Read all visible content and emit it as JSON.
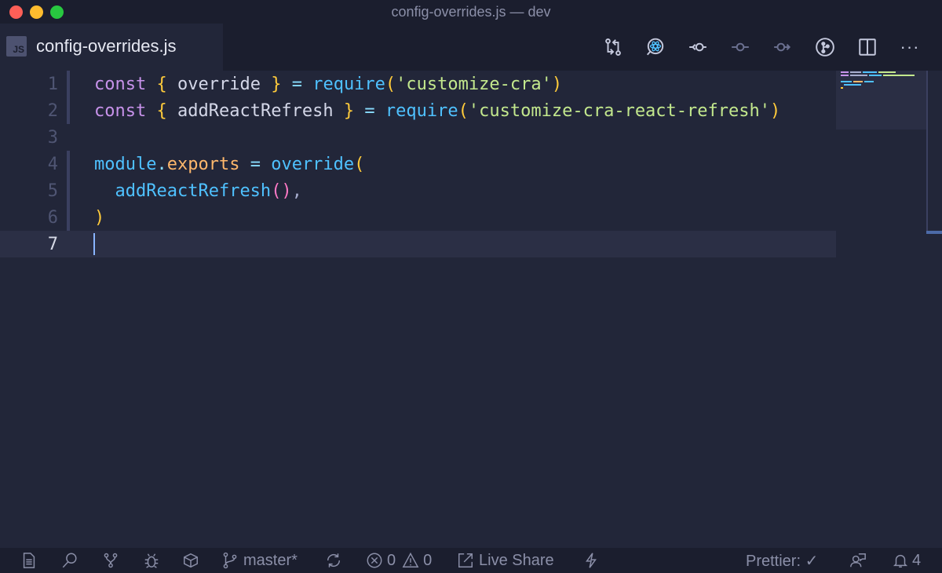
{
  "window": {
    "title": "config-overrides.js — dev"
  },
  "tab": {
    "badge": "JS",
    "label": "config-overrides.js"
  },
  "toolbar": {
    "icons": [
      "compare-changes-icon",
      "react-search-icon",
      "go-back-commit-icon",
      "commit-icon",
      "go-forward-commit-icon",
      "git-graph-icon",
      "split-editor-icon",
      "more-actions-icon"
    ],
    "more_label": "···"
  },
  "editor": {
    "lines": [
      {
        "number": "1"
      },
      {
        "number": "2"
      },
      {
        "number": "3"
      },
      {
        "number": "4"
      },
      {
        "number": "5"
      },
      {
        "number": "6"
      },
      {
        "number": "7"
      }
    ],
    "tokens": {
      "l1": [
        "const",
        " { ",
        "override",
        " } ",
        "= ",
        "require",
        "(",
        "'customize-cra'",
        ")"
      ],
      "l2": [
        "const",
        " { ",
        "addReactRefresh",
        " } ",
        "= ",
        "require",
        "(",
        "'customize-cra-react-refresh'",
        ")"
      ],
      "l4": [
        "module",
        ".",
        "exports",
        " = ",
        "override",
        "("
      ],
      "l5": [
        "  ",
        "addReactRefresh",
        "()",
        ","
      ],
      "l6": [
        ")"
      ]
    },
    "current_line": "7"
  },
  "statusbar": {
    "branch": "master*",
    "errors": "0",
    "warnings": "0",
    "live_share": "Live Share",
    "prettier": "Prettier: ✓",
    "notifications": "4"
  },
  "colors": {
    "background": "#222639",
    "keyword": "#c792ea",
    "brace": "#ffcb3b",
    "function": "#4fc1ff",
    "string": "#c3e88d",
    "property": "#ffb86c"
  }
}
